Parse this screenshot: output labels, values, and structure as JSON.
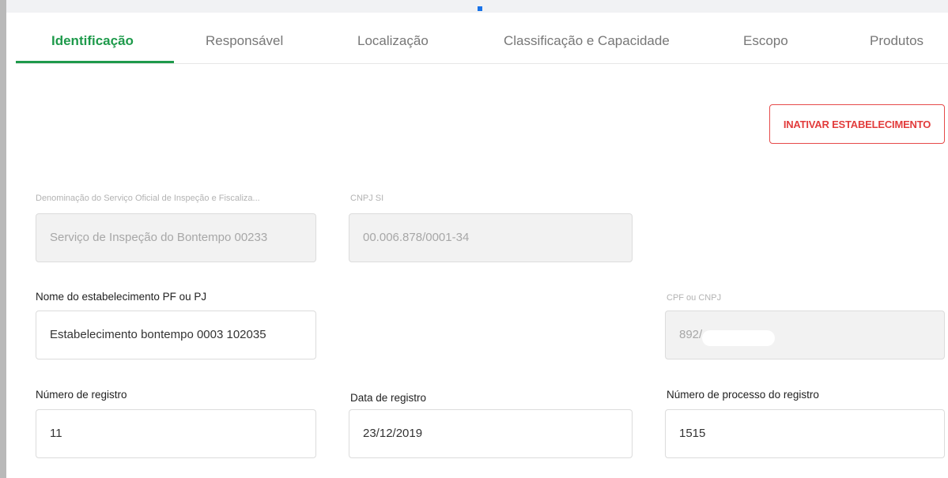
{
  "tabs": [
    {
      "label": "Identificação",
      "active": true
    },
    {
      "label": "Responsável",
      "active": false
    },
    {
      "label": "Localização",
      "active": false
    },
    {
      "label": "Classificação e Capacidade",
      "active": false
    },
    {
      "label": "Escopo",
      "active": false
    },
    {
      "label": "Produtos",
      "active": false
    }
  ],
  "actions": {
    "inactivate_label": "INATIVAR ESTABELECIMENTO"
  },
  "form": {
    "service_name": {
      "label": "Denominação do Serviço Oficial de Inspeção e Fiscaliza...",
      "value": "Serviço de Inspeção do Bontempo 00233"
    },
    "cnpj_si": {
      "label": "CNPJ SI",
      "value": "00.006.878/0001-34"
    },
    "establishment_name": {
      "label": "Nome do estabelecimento PF ou PJ",
      "value": "Estabelecimento bontempo 0003 102035"
    },
    "cpf_cnpj": {
      "label": "CPF ou CNPJ",
      "value": "892/"
    },
    "registration_number": {
      "label": "Número de registro",
      "value": "11"
    },
    "registration_date": {
      "label": "Data de registro",
      "value": "23/12/2019"
    },
    "process_number": {
      "label": "Número de processo do registro",
      "value": "1515"
    }
  },
  "colors": {
    "accent": "#1e9a4b",
    "danger": "#e23c3c",
    "disabled_bg": "#f2f2f2"
  }
}
